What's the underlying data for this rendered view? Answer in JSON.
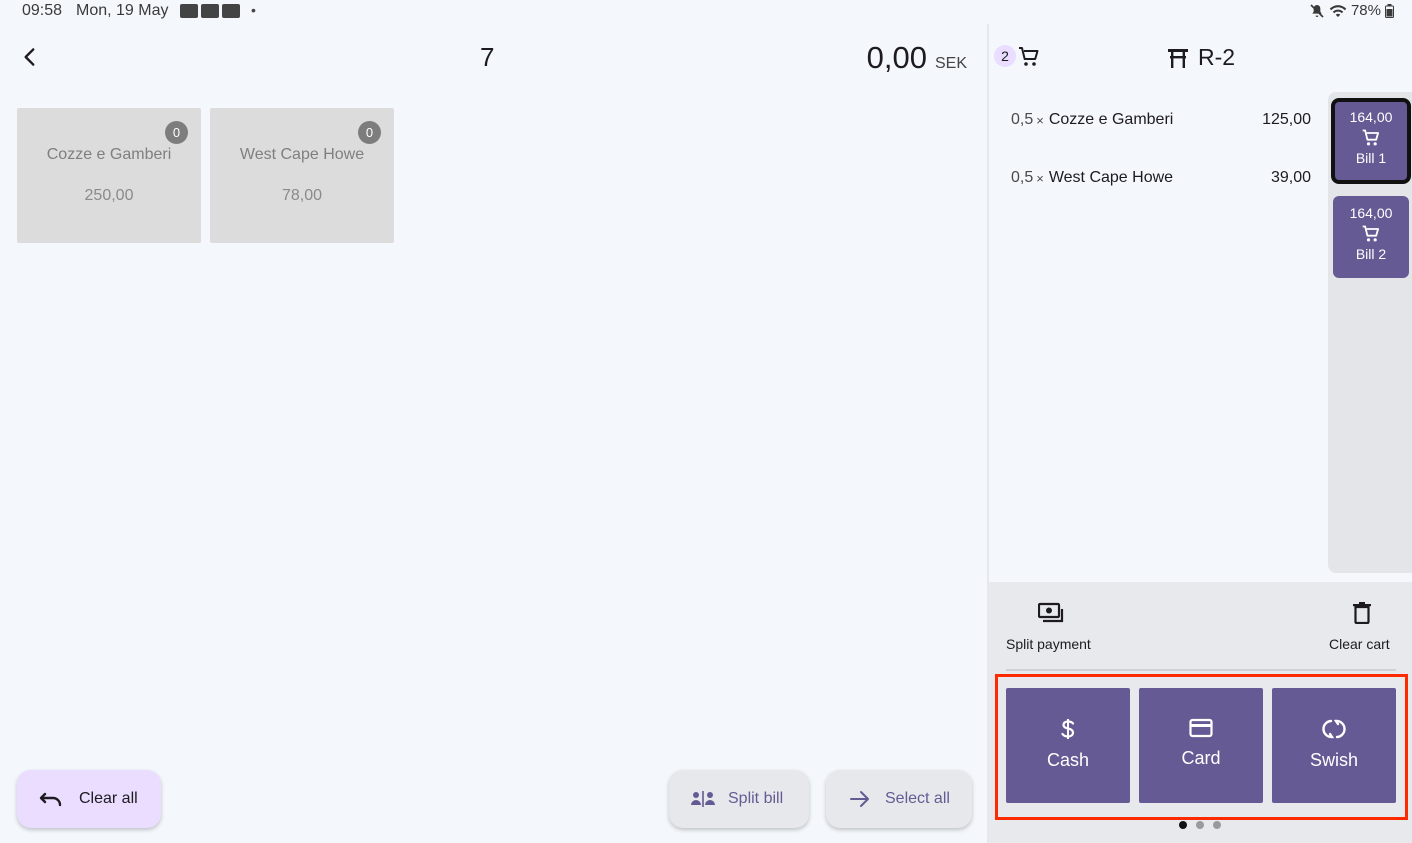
{
  "status_bar": {
    "time": "09:58",
    "date": "Mon, 19 May",
    "battery": "78%"
  },
  "order": {
    "number": "7",
    "total_amount": "0,00",
    "currency": "SEK"
  },
  "products": [
    {
      "name": "Cozze e Gamberi",
      "price": "250,00",
      "count": "0"
    },
    {
      "name": "West Cape Howe",
      "price": "78,00",
      "count": "0"
    }
  ],
  "bottom_actions": {
    "clear_all": "Clear all",
    "split_bill": "Split bill",
    "select_all": "Select all"
  },
  "cart": {
    "item_count": "2",
    "table": "R-2",
    "items": [
      {
        "qty": "0,5",
        "x": "×",
        "name": "Cozze e Gamberi",
        "price": "125,00"
      },
      {
        "qty": "0,5",
        "x": "×",
        "name": "West Cape Howe",
        "price": "39,00"
      }
    ]
  },
  "bills": [
    {
      "amount": "164,00",
      "name": "Bill 1",
      "selected": true
    },
    {
      "amount": "164,00",
      "name": "Bill 2",
      "selected": false
    }
  ],
  "actions": {
    "split_payment": "Split payment",
    "clear_cart": "Clear cart"
  },
  "payment_methods": {
    "cash": "Cash",
    "card": "Card",
    "swish": "Swish"
  },
  "colors": {
    "primary": "#655a93",
    "primary_container": "#eaddff",
    "highlight": "#ff2a00",
    "background": "#f4f8fc"
  }
}
